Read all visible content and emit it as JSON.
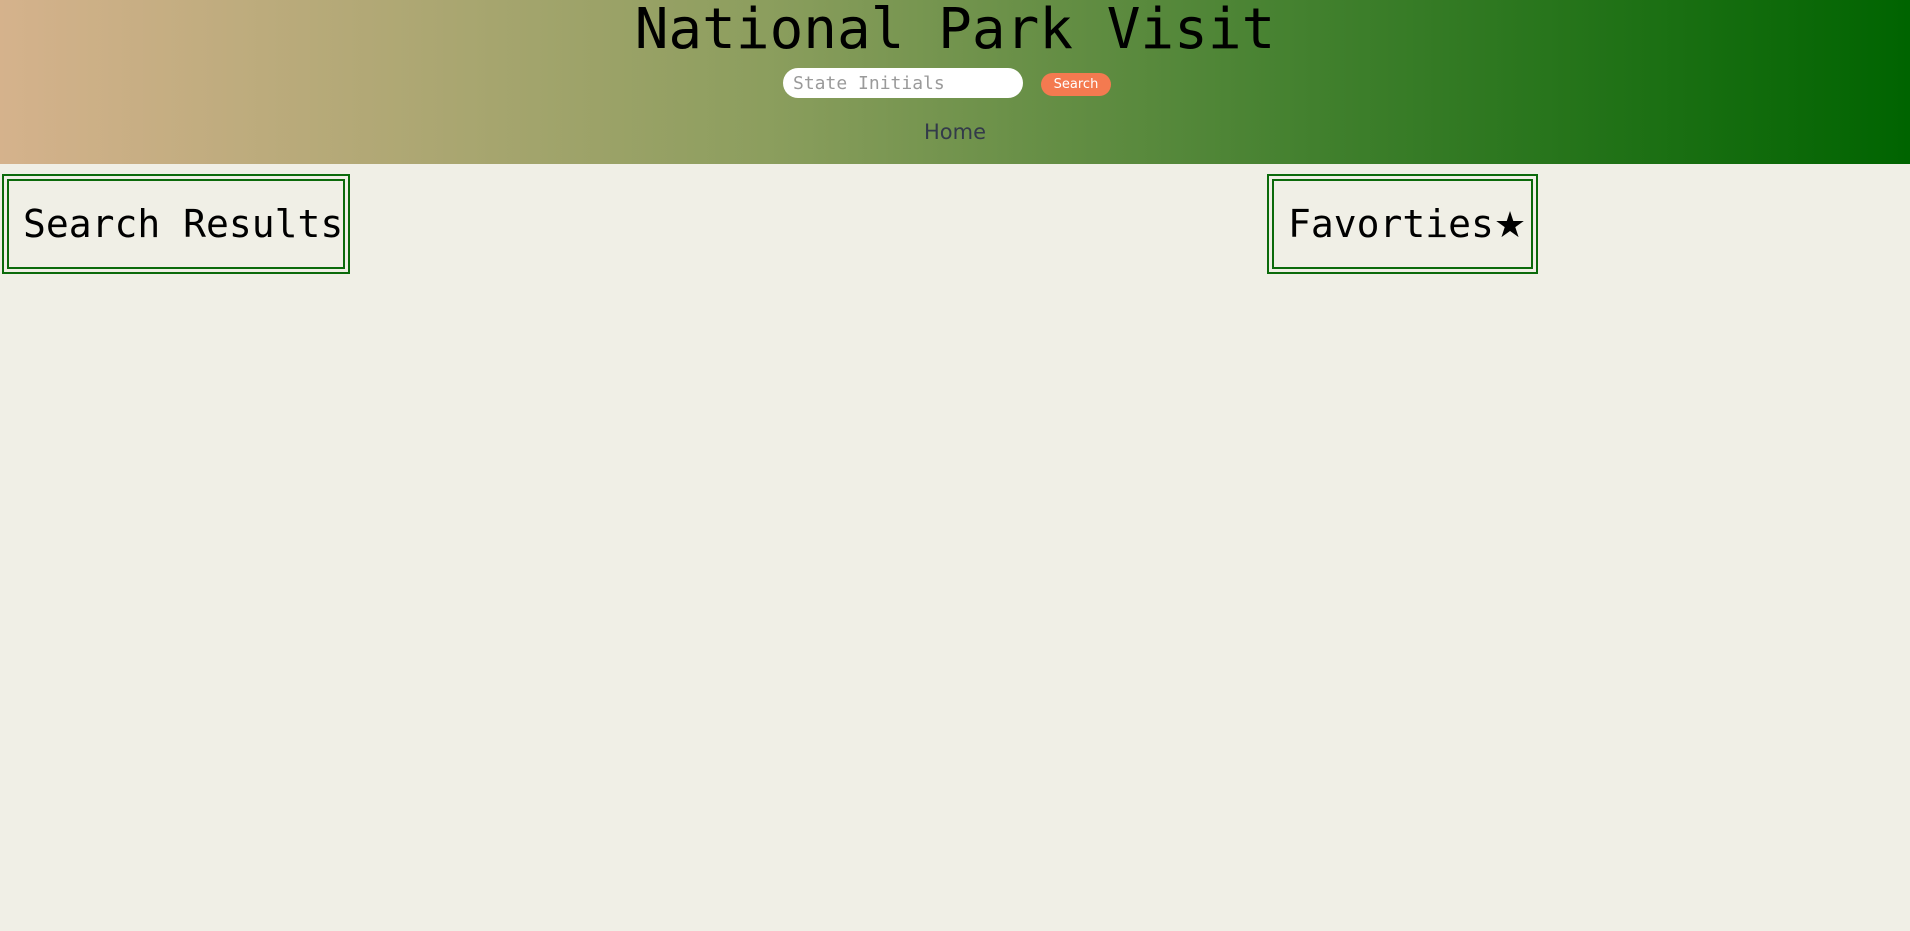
{
  "header": {
    "title": "National Park Visit",
    "search": {
      "placeholder": "State Initials",
      "value": "",
      "button_label": "Search"
    },
    "nav": {
      "home_label": "Home"
    }
  },
  "panels": {
    "results_heading": "Search Results",
    "favorites_heading": "Favorties",
    "favorites_icon": "★"
  },
  "colors": {
    "header_gradient_start": "#d5b28c",
    "header_gradient_end": "#006400",
    "search_button": "#f47a50",
    "panel_border": "#0b6a0b",
    "page_background": "#f0efe6"
  }
}
